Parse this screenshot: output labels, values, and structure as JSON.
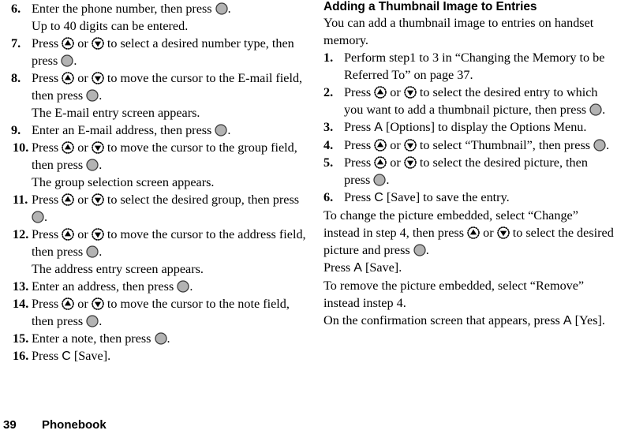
{
  "document": {
    "type": "mobile-phone-user-guide-page",
    "footer": {
      "page_number": "39",
      "chapter": "Phonebook"
    }
  },
  "icons": {
    "select_key": "center-select-key-icon",
    "up_key": "navigation-up-key-icon",
    "down_key": "navigation-down-key-icon",
    "soft_key_a": "A",
    "soft_key_c": "C"
  },
  "colors": {
    "key_fill": "#b3b3b3",
    "key_stroke": "#3a3a3a",
    "text": "#000000",
    "page_background": "#ffffff"
  },
  "left_column": {
    "blocks": [
      {
        "kind": "step",
        "number": "6.",
        "parts": [
          {
            "t": "text",
            "v": "Enter the phone number, then press "
          },
          {
            "t": "icon",
            "v": "select_key"
          },
          {
            "t": "text",
            "v": "."
          }
        ]
      },
      {
        "kind": "note",
        "parts": [
          {
            "t": "text",
            "v": "Up to 40 digits can be entered."
          }
        ]
      },
      {
        "kind": "step",
        "number": "7.",
        "parts": [
          {
            "t": "text",
            "v": "Press "
          },
          {
            "t": "icon",
            "v": "up_key"
          },
          {
            "t": "text",
            "v": " or "
          },
          {
            "t": "icon",
            "v": "down_key"
          },
          {
            "t": "text",
            "v": " to select a desired number type, then press "
          },
          {
            "t": "icon",
            "v": "select_key"
          },
          {
            "t": "text",
            "v": "."
          }
        ]
      },
      {
        "kind": "step",
        "number": "8.",
        "parts": [
          {
            "t": "text",
            "v": "Press "
          },
          {
            "t": "icon",
            "v": "up_key"
          },
          {
            "t": "text",
            "v": " or "
          },
          {
            "t": "icon",
            "v": "down_key"
          },
          {
            "t": "text",
            "v": " to move the cursor to the E-mail field, then press "
          },
          {
            "t": "icon",
            "v": "select_key"
          },
          {
            "t": "text",
            "v": "."
          }
        ]
      },
      {
        "kind": "note",
        "parts": [
          {
            "t": "text",
            "v": "The E-mail entry screen appears."
          }
        ]
      },
      {
        "kind": "step",
        "number": "9.",
        "parts": [
          {
            "t": "text",
            "v": "Enter an E-mail address, then press "
          },
          {
            "t": "icon",
            "v": "select_key"
          },
          {
            "t": "text",
            "v": "."
          }
        ]
      },
      {
        "kind": "step",
        "number": "10.",
        "wide": true,
        "parts": [
          {
            "t": "text",
            "v": "Press "
          },
          {
            "t": "icon",
            "v": "up_key"
          },
          {
            "t": "text",
            "v": " or "
          },
          {
            "t": "icon",
            "v": "down_key"
          },
          {
            "t": "text",
            "v": " to move the cursor to the group field, then press "
          },
          {
            "t": "icon",
            "v": "select_key"
          },
          {
            "t": "text",
            "v": "."
          }
        ]
      },
      {
        "kind": "note",
        "parts": [
          {
            "t": "text",
            "v": "The group selection screen appears."
          }
        ]
      },
      {
        "kind": "step",
        "number": "11.",
        "wide": true,
        "parts": [
          {
            "t": "text",
            "v": "Press "
          },
          {
            "t": "icon",
            "v": "up_key"
          },
          {
            "t": "text",
            "v": " or "
          },
          {
            "t": "icon",
            "v": "down_key"
          },
          {
            "t": "text",
            "v": " to select the desired group, then press "
          },
          {
            "t": "icon",
            "v": "select_key"
          },
          {
            "t": "text",
            "v": "."
          }
        ]
      },
      {
        "kind": "step",
        "number": "12.",
        "wide": true,
        "parts": [
          {
            "t": "text",
            "v": "Press "
          },
          {
            "t": "icon",
            "v": "up_key"
          },
          {
            "t": "text",
            "v": " or "
          },
          {
            "t": "icon",
            "v": "down_key"
          },
          {
            "t": "text",
            "v": " to move the cursor to the address field, then press "
          },
          {
            "t": "icon",
            "v": "select_key"
          },
          {
            "t": "text",
            "v": "."
          }
        ]
      },
      {
        "kind": "note",
        "parts": [
          {
            "t": "text",
            "v": "The address entry screen appears."
          }
        ]
      },
      {
        "kind": "step",
        "number": "13.",
        "wide": true,
        "parts": [
          {
            "t": "text",
            "v": "Enter an address, then press "
          },
          {
            "t": "icon",
            "v": "select_key"
          },
          {
            "t": "text",
            "v": "."
          }
        ]
      },
      {
        "kind": "step",
        "number": "14.",
        "wide": true,
        "parts": [
          {
            "t": "text",
            "v": "Press "
          },
          {
            "t": "icon",
            "v": "up_key"
          },
          {
            "t": "text",
            "v": " or "
          },
          {
            "t": "icon",
            "v": "down_key"
          },
          {
            "t": "text",
            "v": " to move the cursor to the note field, then press "
          },
          {
            "t": "icon",
            "v": "select_key"
          },
          {
            "t": "text",
            "v": "."
          }
        ]
      },
      {
        "kind": "step",
        "number": "15.",
        "wide": true,
        "parts": [
          {
            "t": "text",
            "v": "Enter a note, then press "
          },
          {
            "t": "icon",
            "v": "select_key"
          },
          {
            "t": "text",
            "v": "."
          }
        ]
      },
      {
        "kind": "step",
        "number": "16.",
        "wide": true,
        "parts": [
          {
            "t": "text",
            "v": "Press "
          },
          {
            "t": "key",
            "v": "C"
          },
          {
            "t": "text",
            "v": " [Save]."
          }
        ]
      }
    ]
  },
  "right_column": {
    "heading": "Adding a Thumbnail Image to Entries",
    "blocks": [
      {
        "kind": "para",
        "parts": [
          {
            "t": "text",
            "v": "You can add a thumbnail image to entries on handset memory."
          }
        ]
      },
      {
        "kind": "step",
        "number": "1.",
        "parts": [
          {
            "t": "text",
            "v": "Perform step1 to 3 in “Changing the Memory to be Referred To” on page 37."
          }
        ]
      },
      {
        "kind": "step",
        "number": "2.",
        "parts": [
          {
            "t": "text",
            "v": "Press "
          },
          {
            "t": "icon",
            "v": "up_key"
          },
          {
            "t": "text",
            "v": " or "
          },
          {
            "t": "icon",
            "v": "down_key"
          },
          {
            "t": "text",
            "v": " to select the desired entry to which you want to add a thumbnail picture, then press "
          },
          {
            "t": "icon",
            "v": "select_key"
          },
          {
            "t": "text",
            "v": "."
          }
        ]
      },
      {
        "kind": "step",
        "number": "3.",
        "parts": [
          {
            "t": "text",
            "v": "Press "
          },
          {
            "t": "key",
            "v": "A"
          },
          {
            "t": "text",
            "v": " [Options] to display the Options Menu."
          }
        ]
      },
      {
        "kind": "step",
        "number": "4.",
        "parts": [
          {
            "t": "text",
            "v": "Press "
          },
          {
            "t": "icon",
            "v": "up_key"
          },
          {
            "t": "text",
            "v": " or "
          },
          {
            "t": "icon",
            "v": "down_key"
          },
          {
            "t": "text",
            "v": " to select “Thumbnail”, then press "
          },
          {
            "t": "icon",
            "v": "select_key"
          },
          {
            "t": "text",
            "v": "."
          }
        ]
      },
      {
        "kind": "step",
        "number": "5.",
        "parts": [
          {
            "t": "text",
            "v": "Press "
          },
          {
            "t": "icon",
            "v": "up_key"
          },
          {
            "t": "text",
            "v": " or "
          },
          {
            "t": "icon",
            "v": "down_key"
          },
          {
            "t": "text",
            "v": " to select the desired picture, then press "
          },
          {
            "t": "icon",
            "v": "select_key"
          },
          {
            "t": "text",
            "v": "."
          }
        ]
      },
      {
        "kind": "step",
        "number": "6.",
        "parts": [
          {
            "t": "text",
            "v": "Press "
          },
          {
            "t": "key",
            "v": "C"
          },
          {
            "t": "text",
            "v": " [Save] to save the entry."
          }
        ]
      },
      {
        "kind": "para",
        "parts": [
          {
            "t": "text",
            "v": "To change the picture embedded, select “Change” instead in step 4, then press "
          },
          {
            "t": "icon",
            "v": "up_key"
          },
          {
            "t": "text",
            "v": " or "
          },
          {
            "t": "icon",
            "v": "down_key"
          },
          {
            "t": "text",
            "v": " to select the desired picture and press "
          },
          {
            "t": "icon",
            "v": "select_key"
          },
          {
            "t": "text",
            "v": "."
          }
        ]
      },
      {
        "kind": "para",
        "parts": [
          {
            "t": "text",
            "v": "Press "
          },
          {
            "t": "key",
            "v": "A"
          },
          {
            "t": "text",
            "v": " [Save]."
          }
        ]
      },
      {
        "kind": "para",
        "parts": [
          {
            "t": "text",
            "v": "To remove the picture embedded, select “Remove” instead instep 4."
          }
        ]
      },
      {
        "kind": "para",
        "parts": [
          {
            "t": "text",
            "v": "On the confirmation screen that appears, press "
          },
          {
            "t": "key",
            "v": "A"
          },
          {
            "t": "text",
            "v": " [Yes]."
          }
        ]
      }
    ]
  }
}
